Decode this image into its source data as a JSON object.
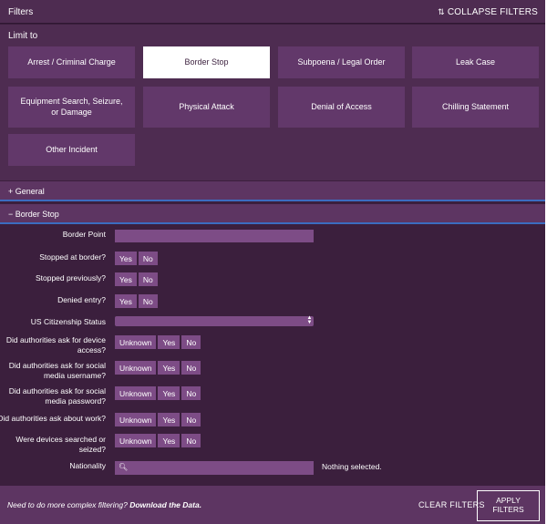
{
  "header": {
    "title": "Filters",
    "collapse_icon": "⇅",
    "collapse_label": "COLLAPSE FILTERS"
  },
  "limit": {
    "label": "Limit to",
    "tiles": [
      {
        "label": "Arrest / Criminal Charge",
        "selected": false
      },
      {
        "label": "Border Stop",
        "selected": true
      },
      {
        "label": "Subpoena / Legal Order",
        "selected": false
      },
      {
        "label": "Leak Case",
        "selected": false
      },
      {
        "label": "Equipment Search, Seizure, or Damage",
        "selected": false
      },
      {
        "label": "Physical Attack",
        "selected": false
      },
      {
        "label": "Denial of Access",
        "selected": false
      },
      {
        "label": "Chilling Statement",
        "selected": false
      },
      {
        "label": "Other Incident",
        "selected": false
      }
    ]
  },
  "sections": {
    "general": {
      "icon": "+",
      "label": "General"
    },
    "border_stop": {
      "icon": "−",
      "label": "Border Stop"
    }
  },
  "form": {
    "border_point": {
      "label": "Border Point",
      "value": ""
    },
    "stopped_at_border": {
      "label": "Stopped at border?",
      "options": [
        "Yes",
        "No"
      ]
    },
    "stopped_previously": {
      "label": "Stopped previously?",
      "options": [
        "Yes",
        "No"
      ]
    },
    "denied_entry": {
      "label": "Denied entry?",
      "options": [
        "Yes",
        "No"
      ]
    },
    "us_citizenship": {
      "label": "US Citizenship Status",
      "value": ""
    },
    "device_access": {
      "label": "Did authorities ask for device access?",
      "options": [
        "Unknown",
        "Yes",
        "No"
      ]
    },
    "social_username": {
      "label": "Did authorities ask for social media username?",
      "options": [
        "Unknown",
        "Yes",
        "No"
      ]
    },
    "social_password": {
      "label": "Did authorities ask for social media password?",
      "options": [
        "Unknown",
        "Yes",
        "No"
      ]
    },
    "ask_about_work": {
      "label": "Did authorities ask about work?",
      "options": [
        "Unknown",
        "Yes",
        "No"
      ]
    },
    "devices_searched": {
      "label": "Were devices searched or seized?",
      "options": [
        "Unknown",
        "Yes",
        "No"
      ]
    },
    "nationality": {
      "label": "Nationality",
      "search_icon": "search-icon",
      "status": "Nothing selected."
    }
  },
  "footer": {
    "hint_prefix": "Need to do more complex filtering? ",
    "hint_link": "Download the Data.",
    "clear_label": "CLEAR FILTERS",
    "apply_label": "APPLY FILTERS"
  }
}
